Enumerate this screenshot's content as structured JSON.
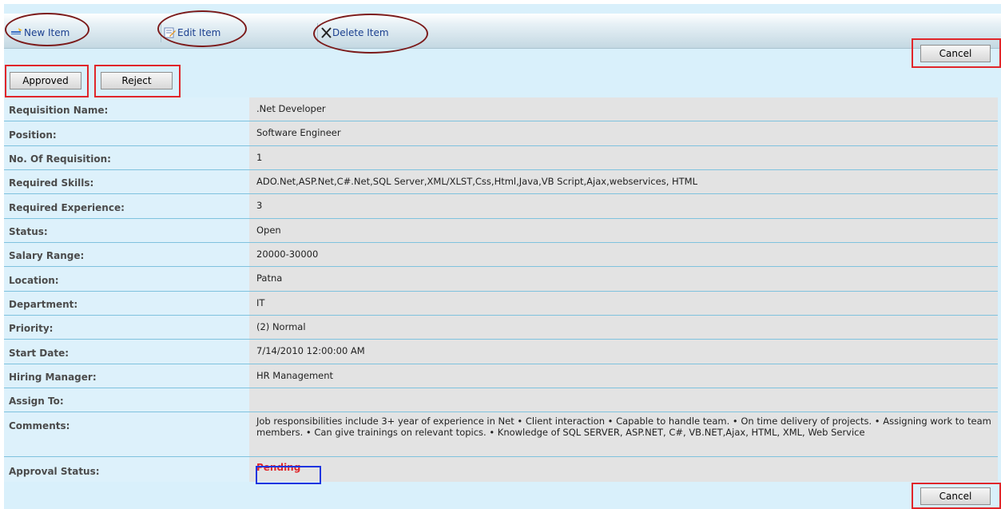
{
  "toolbar": {
    "new_item": "New Item",
    "edit_item": "Edit Item",
    "delete_item": "Delete Item"
  },
  "buttons": {
    "cancel": "Cancel",
    "approved": "Approved",
    "reject": "Reject"
  },
  "fields": [
    {
      "label": "Requisition Name:",
      "value": ".Net Developer"
    },
    {
      "label": "Position:",
      "value": "Software Engineer"
    },
    {
      "label": "No. Of Requisition:",
      "value": "1"
    },
    {
      "label": "Required Skills:",
      "value": "ADO.Net,ASP.Net,C#.Net,SQL Server,XML/XLST,Css,Html,Java,VB Script,Ajax,webservices, HTML"
    },
    {
      "label": "Required Experience:",
      "value": "3"
    },
    {
      "label": "Status:",
      "value": "Open"
    },
    {
      "label": "Salary Range:",
      "value": "20000-30000"
    },
    {
      "label": "Location:",
      "value": "Patna"
    },
    {
      "label": "Department:",
      "value": "IT"
    },
    {
      "label": "Priority:",
      "value": "(2) Normal"
    },
    {
      "label": "Start Date:",
      "value": "7/14/2010 12:00:00 AM"
    },
    {
      "label": "Hiring Manager:",
      "value": "HR Management"
    },
    {
      "label": "Assign To:",
      "value": ""
    },
    {
      "label": "Comments:",
      "value": "Job responsibilities include 3+ year of experience in Net • Client interaction • Capable to handle team. • On time delivery of projects. • Assigning work to team members. • Can give trainings on relevant topics. • Knowledge of SQL SERVER, ASP.NET, C#, VB.NET,Ajax, HTML, XML, Web Service"
    },
    {
      "label": "Approval Status:",
      "value": "Pending"
    }
  ],
  "colors": {
    "highlight_red": "#e0262a",
    "highlight_blue": "#1f35e0",
    "annotation_oval": "#7b1a1a",
    "link_blue": "#1a3f8f"
  }
}
